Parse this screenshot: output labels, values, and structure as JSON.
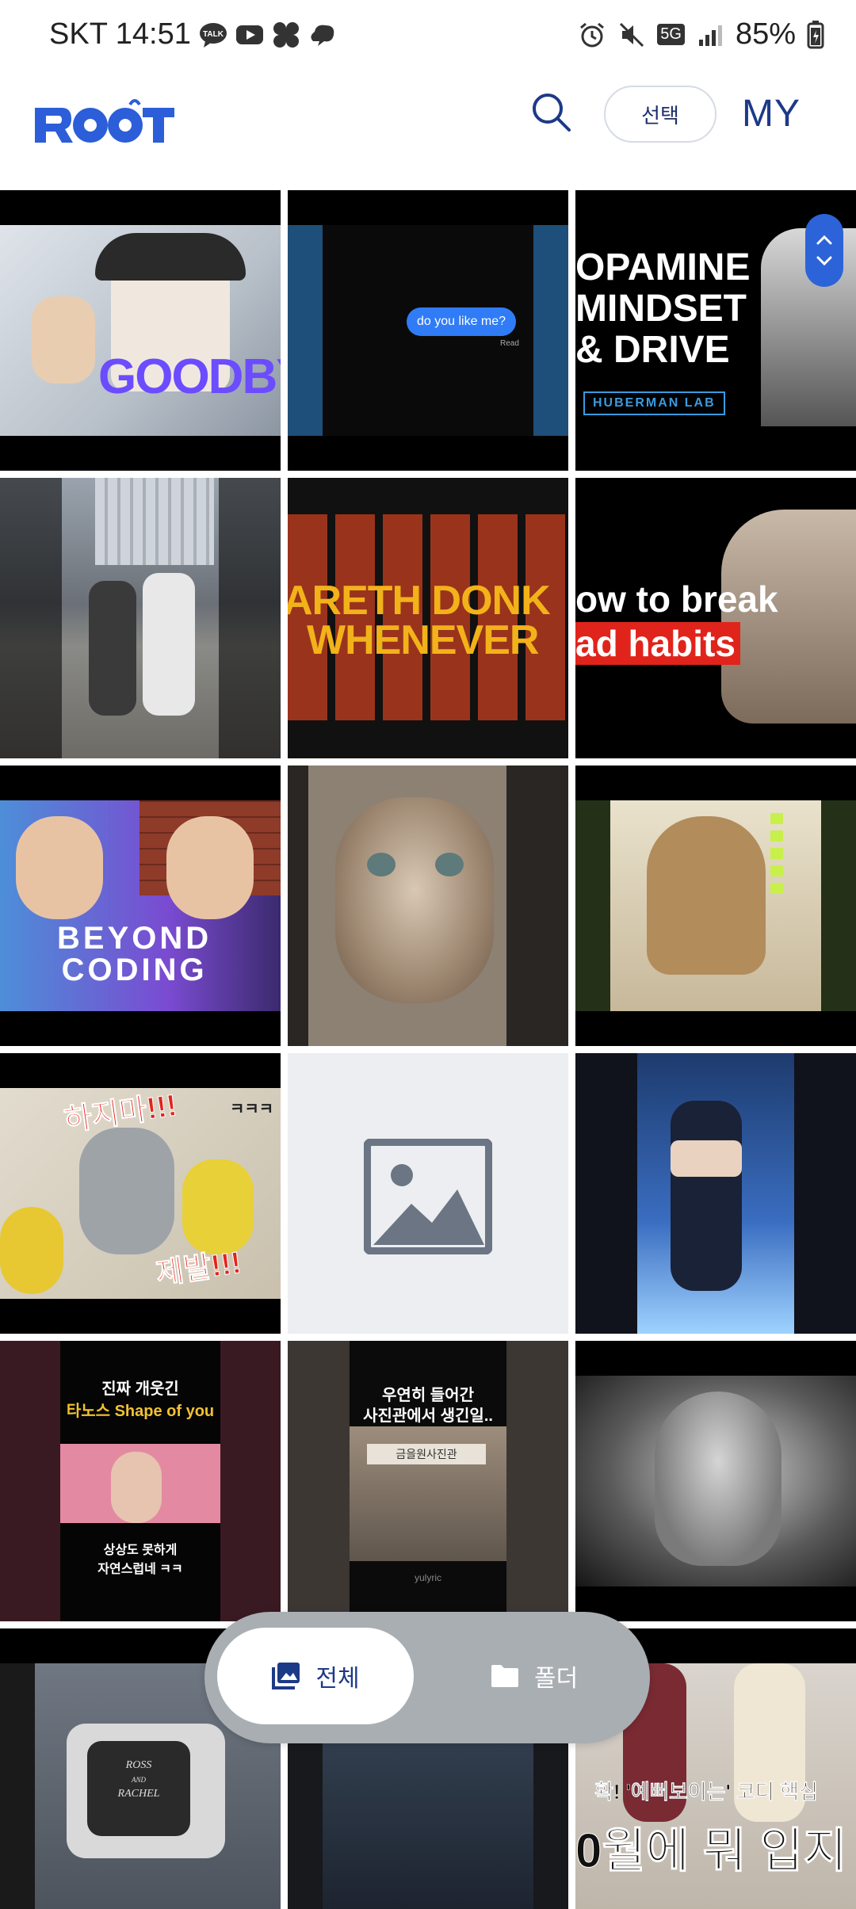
{
  "status_bar": {
    "carrier_time": "SKT 14:51",
    "network": "5G",
    "battery": "85%"
  },
  "app_bar": {
    "logo_text": "ROOT",
    "select_label": "선택",
    "my_label": "MY"
  },
  "tiles": {
    "t1": {
      "caption": "GOODBYE"
    },
    "t2": {
      "caption": "do you like me?",
      "small": "Read"
    },
    "t3": {
      "caption1": "OPAMINE",
      "caption2": "MINDSET",
      "caption3": "& DRIVE",
      "badge": "HUBERMAN LAB"
    },
    "t5": {
      "caption1": "ARETH DONK",
      "caption2": "WHENEVER"
    },
    "t6": {
      "caption1": "ow to break",
      "caption2": "ad habits"
    },
    "t7": {
      "caption1": "BEYOND",
      "caption2": "CODING"
    },
    "t10": {
      "caption1": "하지마!!!",
      "caption2": "제발!!!",
      "side": "ㅋㅋㅋ"
    },
    "t13": {
      "caption1": "진짜 개웃긴",
      "caption2": "타노스 Shape of you",
      "caption3": "상상도 못하게",
      "caption4": "자연스럽네 ㅋㅋ"
    },
    "t14": {
      "caption1": "우연히 들어간",
      "caption2": "사진관에서 생긴일..",
      "sign": "금을원사진관",
      "credit": "yulyric"
    },
    "t16": {
      "caption1": "ROSS",
      "caption2": "AND",
      "caption3": "RACHEL"
    },
    "t18": {
      "caption1": "확! '예뻐보이는' 코디 핵심",
      "caption2": "0월에 뭐 입지"
    }
  },
  "bottom_nav": {
    "all_label": "전체",
    "folder_label": "폴더"
  }
}
